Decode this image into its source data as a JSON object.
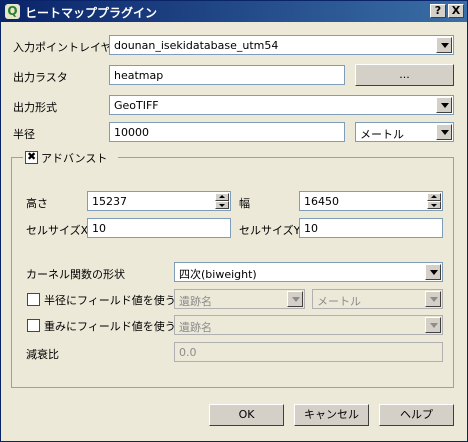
{
  "window": {
    "title": "ヒートマッププラグイン",
    "help_btn": "?",
    "close_btn": "X"
  },
  "input_layer": {
    "label": "入力ポイントレイヤ",
    "value": "dounan_isekidatabase_utm54"
  },
  "output_raster": {
    "label": "出力ラスタ",
    "value": "heatmap",
    "browse": "..."
  },
  "output_format": {
    "label": "出力形式",
    "value": "GeoTIFF"
  },
  "radius": {
    "label": "半径",
    "value": "10000",
    "unit": "メートル"
  },
  "advanced": {
    "label": "アドバンスト",
    "height_label": "高さ",
    "height": "15237",
    "width_label": "幅",
    "width": "16450",
    "cellx_label": "セルサイズX",
    "cellx": "10",
    "celly_label": "セルサイズY",
    "celly": "10",
    "kernel_label": "カーネル関数の形状",
    "kernel": "四次(biweight)",
    "radius_field_label": "半径にフィールド値を使う",
    "radius_field": "遺跡名",
    "radius_field_unit": "メートル",
    "weight_field_label": "重みにフィールド値を使う",
    "weight_field": "遺跡名",
    "decay_label": "減衰比",
    "decay": "0.0"
  },
  "buttons": {
    "ok": "OK",
    "cancel": "キャンセル",
    "help": "ヘルプ"
  }
}
